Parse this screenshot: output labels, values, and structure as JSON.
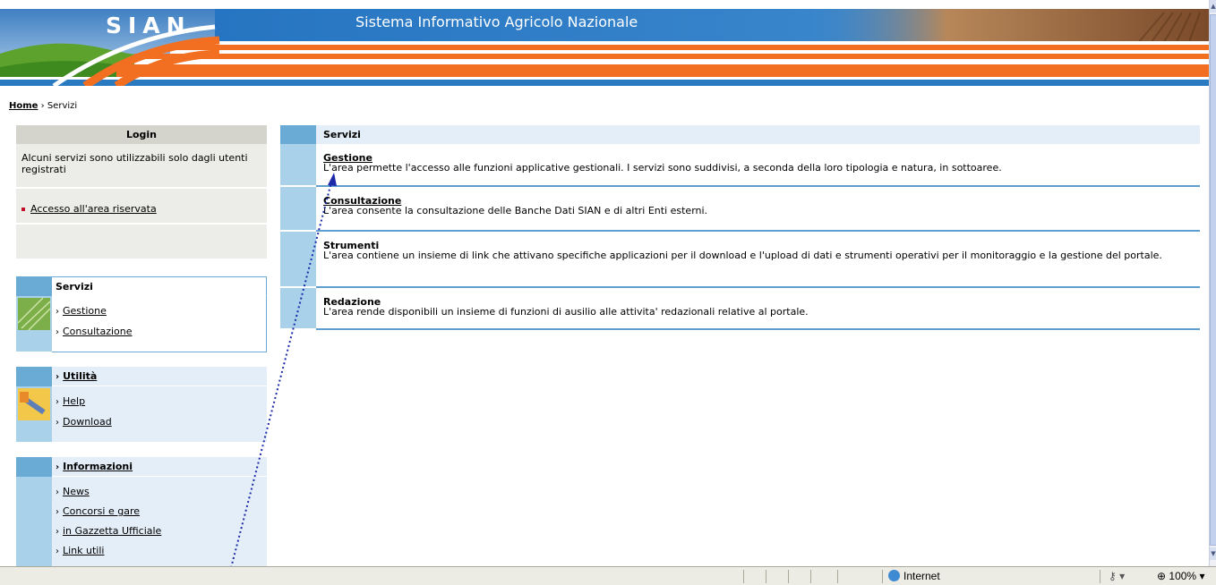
{
  "banner": {
    "logo": "SIAN",
    "title": "Sistema Informativo Agricolo Nazionale"
  },
  "breadcrumb": {
    "home": "Home",
    "separator": "›",
    "current": "Servizi"
  },
  "login": {
    "header": "Login",
    "text": "Alcuni servizi sono utilizzabili solo dagli utenti registrati",
    "link": "Accesso all'area riservata"
  },
  "nav": {
    "chevron": "›",
    "servizi": {
      "header": "Servizi",
      "items": [
        "Gestione",
        "Consultazione"
      ]
    },
    "utilita": {
      "header": "Utilità",
      "items": [
        "Help",
        "Download"
      ]
    },
    "informazioni": {
      "header": "Informazioni",
      "items": [
        "News",
        "Concorsi e gare",
        "in Gazzetta Ufficiale",
        "Link utili"
      ]
    }
  },
  "main": {
    "header": "Servizi",
    "rows": [
      {
        "title": "Gestione",
        "linked": true,
        "text": "L'area permette l'accesso alle funzioni applicative gestionali. I servizi sono suddivisi, a seconda della loro tipologia e natura, in sottoaree."
      },
      {
        "title": "Consultazione",
        "linked": true,
        "text": "L'area consente la consultazione delle Banche Dati SIAN e di altri Enti esterni."
      },
      {
        "title": "Strumenti",
        "linked": false,
        "text": "L'area contiene un insieme di link che attivano specifiche applicazioni per il download e l'upload di dati e strumenti operativi per il monitoraggio e la gestione del portale."
      },
      {
        "title": "Redazione",
        "linked": false,
        "text": "L'area rende disponibili un insieme di funzioni di ausilio alle attivita' redazionali relative al portale."
      }
    ]
  },
  "statusbar": {
    "zone": "Internet",
    "zoom": "100%",
    "dropdown": "▾",
    "icons": [
      "globe-icon",
      "lock-icon",
      "zoom-icon"
    ]
  },
  "colors": {
    "accent_blue": "#6aabd6",
    "light_blue": "#a9d1ea",
    "panel_blue": "#e4eef8",
    "banner_blue": "#2a7ac2",
    "banner_orange": "#f26f21"
  }
}
